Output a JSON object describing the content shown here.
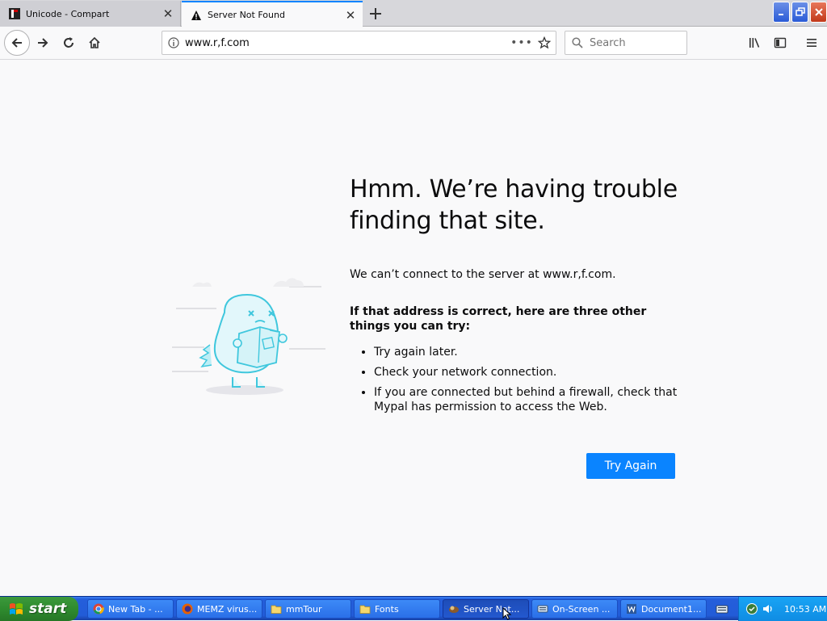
{
  "browser": {
    "tabs": [
      {
        "label": "Unicode - Compart",
        "icon": "compart-favicon",
        "active": false
      },
      {
        "label": "Server Not Found",
        "icon": "warning-icon",
        "active": true
      }
    ],
    "url": "www.r,f.com",
    "search_placeholder": "Search",
    "accent_color": "#0a84ff"
  },
  "error_page": {
    "title": "Hmm. We’re having trouble finding that site.",
    "description": "We can’t connect to the server at www.r,f.com.",
    "subhead": "If that address is correct, here are three other things you can try:",
    "suggestions": [
      "Try again later.",
      "Check your network connection.",
      "If you are connected but behind a firewall, check that Mypal has permission to access the Web."
    ],
    "try_again_label": "Try Again"
  },
  "taskbar": {
    "start_label": "start",
    "items": [
      {
        "label": "New Tab - ...",
        "icon": "chrome-icon",
        "active": false
      },
      {
        "label": "MEMZ virus...",
        "icon": "firefox-icon",
        "active": false
      },
      {
        "label": "mmTour",
        "icon": "folder-icon",
        "active": false
      },
      {
        "label": "Fonts",
        "icon": "folder-icon",
        "active": false
      },
      {
        "label": "Server Not...",
        "icon": "mypal-icon",
        "active": true
      },
      {
        "label": "On-Screen ...",
        "icon": "keyboard-icon",
        "active": false
      },
      {
        "label": "Document1...",
        "icon": "word-icon",
        "active": false
      }
    ],
    "clock": "10:53 AM"
  }
}
